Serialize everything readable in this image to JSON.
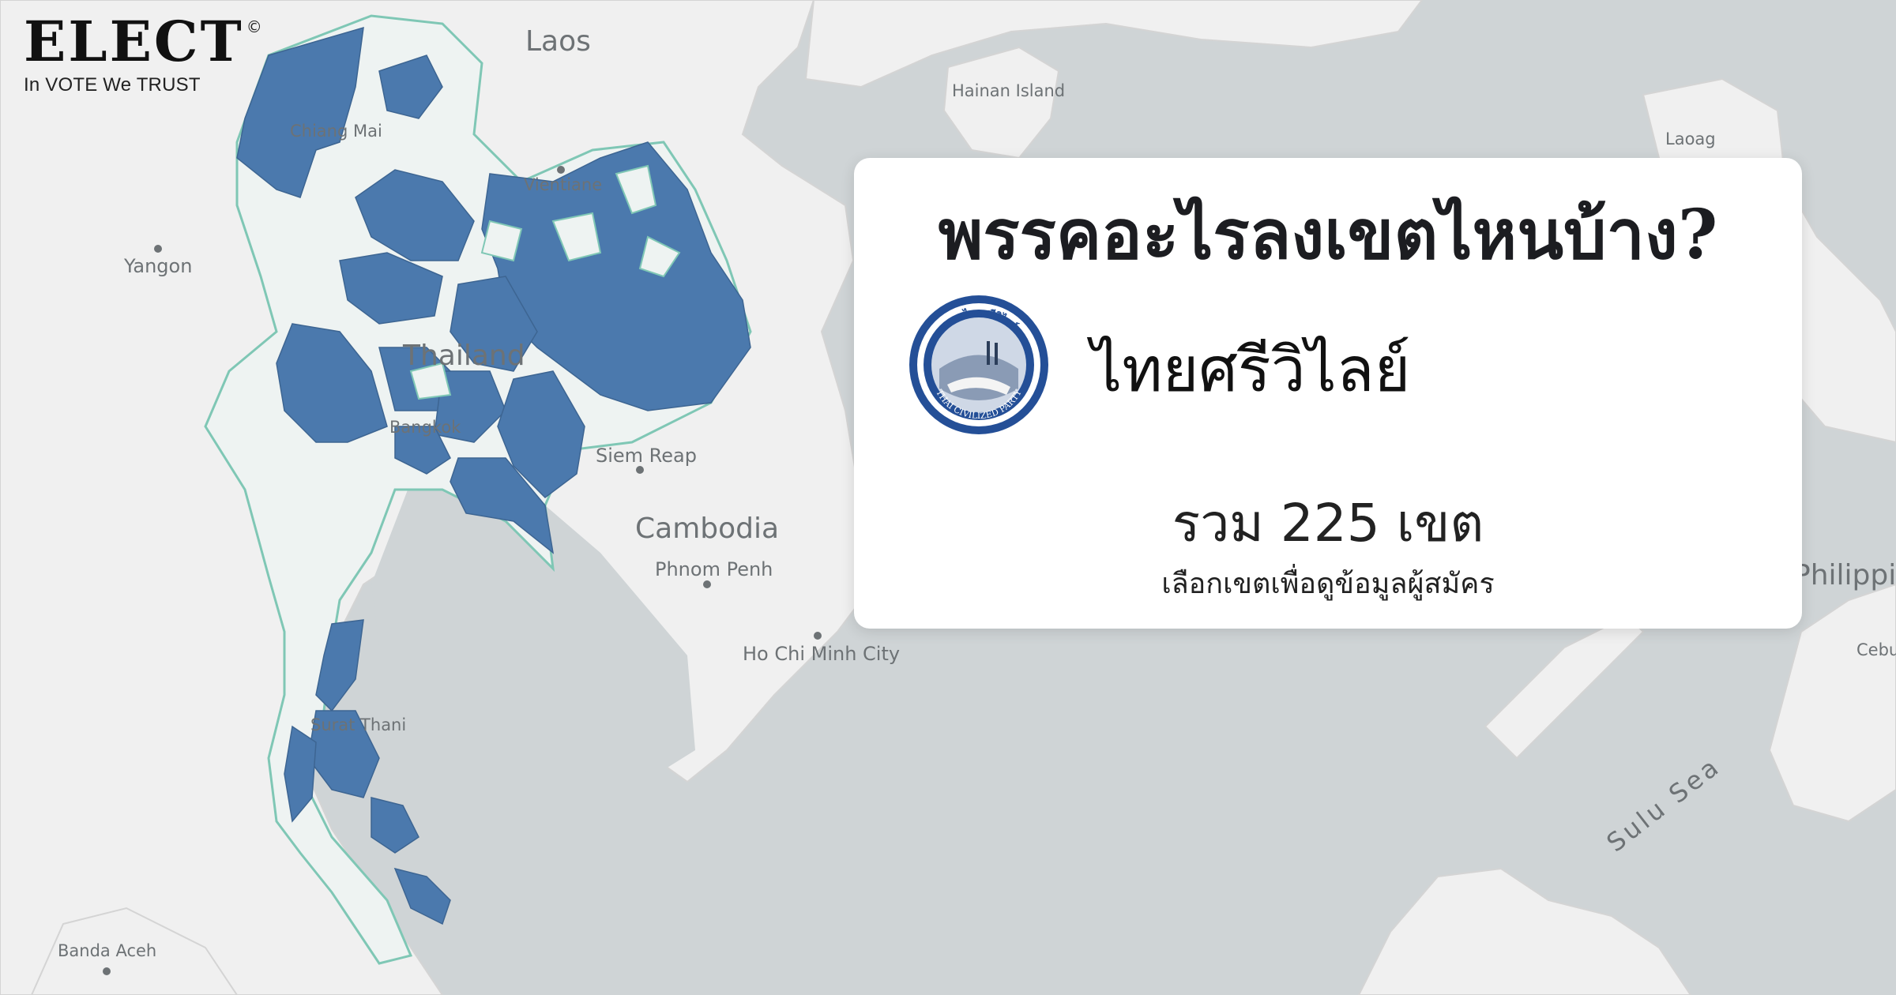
{
  "brand": {
    "logo_text": "ELECT",
    "copyright_mark": "©",
    "tagline": "In VOTE We TRUST"
  },
  "map": {
    "labels": {
      "laos": "Laos",
      "hainan": "Hainan Island",
      "laoag": "Laoag",
      "chiang_mai": "Chiang Mai",
      "vientiane": "Vientiane",
      "yangon": "Yangon",
      "thailand": "Thailand",
      "bangkok": "Bangkok",
      "siem_reap": "Siem Reap",
      "cambodia": "Cambodia",
      "phnom_penh": "Phnom Penh",
      "ho_chi_minh": "Ho Chi Minh City",
      "philippines": "Philippines",
      "cebu": "Cebu",
      "sulu_sea": "Sulu Sea",
      "surat_thani": "Surat Thani",
      "banda_aceh": "Banda Aceh"
    },
    "colors": {
      "water": "#cfd4d6",
      "land": "#f0f0f0",
      "contested": "#4b79ad",
      "uncontested": "#eef3f2",
      "boundary": "#7fc7b5"
    }
  },
  "card": {
    "title": "พรรคอะไรลงเขตไหนบ้าง?",
    "party_name": "ไทยศรีวิไลย์",
    "logo_text_top": "พรรคไทยศรีวิไลย์",
    "logo_text_bottom": "THAI CIVILIZED PARTY",
    "total_label": "รวม 225 เขต",
    "hint": "เลือกเขตเพื่อดูข้อมูลผู้สมัคร"
  }
}
